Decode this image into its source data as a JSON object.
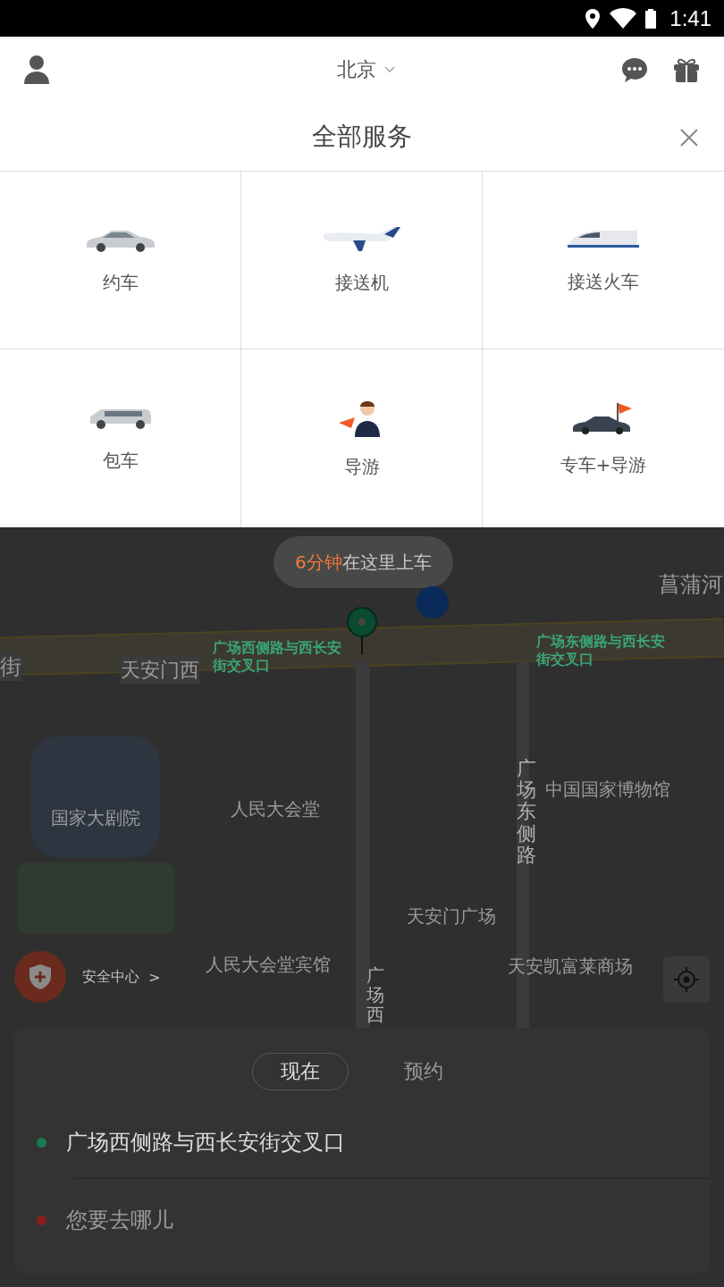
{
  "status_bar": {
    "time": "1:41"
  },
  "header": {
    "city": "北京"
  },
  "services": {
    "title": "全部服务",
    "items": [
      {
        "label": "约车",
        "kind": "sedan"
      },
      {
        "label": "接送机",
        "kind": "plane"
      },
      {
        "label": "接送火车",
        "kind": "train"
      },
      {
        "label": "包车",
        "kind": "van"
      },
      {
        "label": "导游",
        "kind": "guide"
      },
      {
        "label": "专车+导游",
        "kind": "car-guide"
      }
    ]
  },
  "map": {
    "pickup_bubble": {
      "eta": "6分钟",
      "text": "在这里上车"
    },
    "labels": [
      {
        "text": "菖蒲河",
        "kind": "place"
      },
      {
        "text": "街",
        "kind": "road"
      },
      {
        "text": "天安门西",
        "kind": "road"
      },
      {
        "text": "广场西侧路与西长安街交叉口",
        "kind": "stop"
      },
      {
        "text": "广场东侧路与西长安街交叉口",
        "kind": "stop"
      },
      {
        "text": "广场东侧路",
        "kind": "vertical"
      },
      {
        "text": "中国国家博物馆",
        "kind": "place"
      },
      {
        "text": "国家大剧院",
        "kind": "place"
      },
      {
        "text": "人民大会堂",
        "kind": "place"
      },
      {
        "text": "天安门广场",
        "kind": "place"
      },
      {
        "text": "人民大会堂宾馆",
        "kind": "place"
      },
      {
        "text": "广场西",
        "kind": "vertical"
      },
      {
        "text": "天安凯富莱商场",
        "kind": "place"
      }
    ],
    "safety": {
      "label": "安全中心",
      "arrow": ">"
    }
  },
  "panel": {
    "tabs": [
      {
        "label": "现在",
        "selected": true
      },
      {
        "label": "预约",
        "selected": false
      }
    ],
    "origin": {
      "value": "广场西侧路与西长安街交叉口",
      "color": "#1a7a52"
    },
    "destination": {
      "placeholder": "您要去哪儿",
      "color": "#8a1f1f"
    }
  }
}
